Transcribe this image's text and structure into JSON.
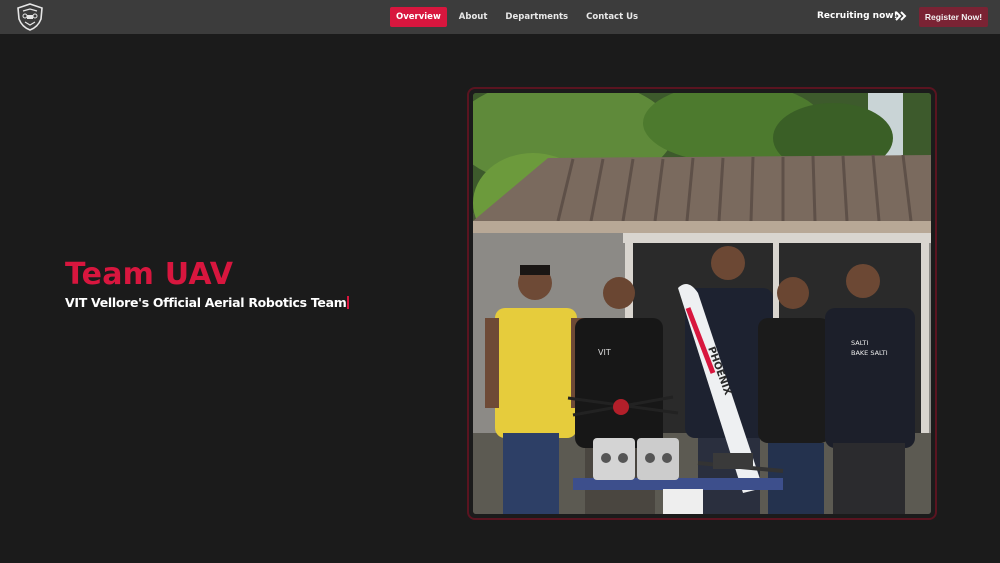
{
  "nav": {
    "logo_icon": "shield-drone-logo-icon",
    "links": [
      {
        "label": "Overview",
        "active": true
      },
      {
        "label": "About",
        "active": false
      },
      {
        "label": "Departments",
        "active": false
      },
      {
        "label": "Contact Us",
        "active": false
      }
    ],
    "recruiting_text": "Recruiting now!",
    "chevron_icon": "double-chevron-right-icon",
    "register_label": "Register Now!"
  },
  "hero": {
    "title": "Team UAV",
    "subtitle": "VIT Vellore's Official Aerial Robotics Team"
  },
  "photo": {
    "shirt_print_1": "VIT",
    "shirt_print_2": "PHOENIX",
    "shirt_text_line1": "SALTI",
    "shirt_text_line2": "BAKE SALTI"
  },
  "colors": {
    "accent": "#d8163e",
    "register_bg": "#7a2334",
    "navbar_bg": "#3c3c3c",
    "page_bg": "#1b1b1b",
    "frame_border": "#5a1420"
  }
}
